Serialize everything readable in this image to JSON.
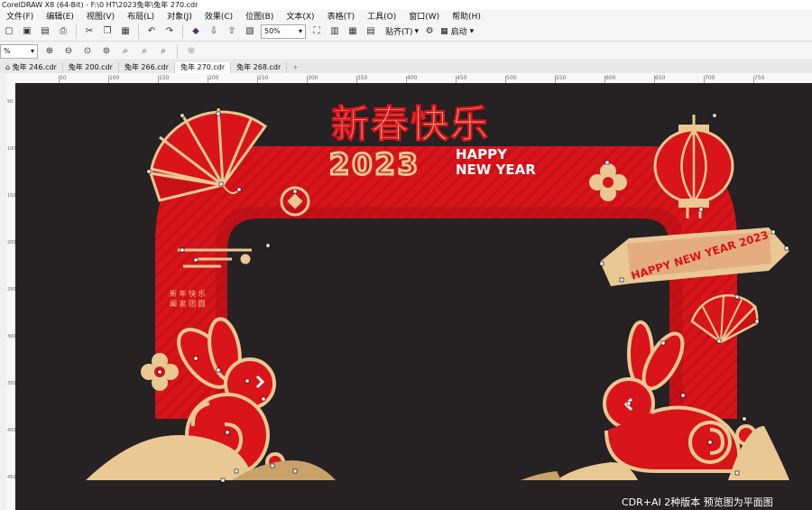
{
  "window": {
    "title": "CorelDRAW X8 (64-Bit) - F:\\0 HT\\2023兔年\\兔年 270.cdr"
  },
  "menu": [
    "文件(F)",
    "编辑(E)",
    "视图(V)",
    "布局(L)",
    "对象(J)",
    "效果(C)",
    "位图(B)",
    "文本(X)",
    "表格(T)",
    "工具(O)",
    "窗口(W)",
    "帮助(H)"
  ],
  "toolbar": {
    "zoom": "50%",
    "snap_label": "贴齐(T)",
    "launch_label": "启动"
  },
  "property_bar": {
    "zoom": "%"
  },
  "tabs": [
    {
      "label": "兔年 246.cdr",
      "active": false
    },
    {
      "label": "兔年 200.cdr",
      "active": false
    },
    {
      "label": "兔年 266.cdr",
      "active": false
    },
    {
      "label": "兔年 270.cdr",
      "active": true
    },
    {
      "label": "兔年 268.cdr",
      "active": false
    }
  ],
  "ruler": {
    "h_ticks": [
      "50",
      "100",
      "150",
      "200",
      "250",
      "300",
      "350",
      "400",
      "450",
      "500",
      "550",
      "600",
      "650",
      "700",
      "750"
    ],
    "v_ticks": [
      "50",
      "100",
      "150",
      "200",
      "250",
      "300",
      "350",
      "400",
      "450"
    ]
  },
  "artwork": {
    "title": "新春快乐",
    "year": "2023",
    "happy": "HAPPY",
    "new_year": "NEW YEAR",
    "banner": "HAPPY NEW YEAR 2023",
    "side_text_1": "新 年 快 乐",
    "side_text_2": "阖 家 团 圆",
    "colors": {
      "red": "#d9141b",
      "gold": "#e9c893",
      "canvas": "#262122"
    }
  },
  "watermark": {
    "text": "CDR+AI 2种版本   预览图为平面图"
  }
}
